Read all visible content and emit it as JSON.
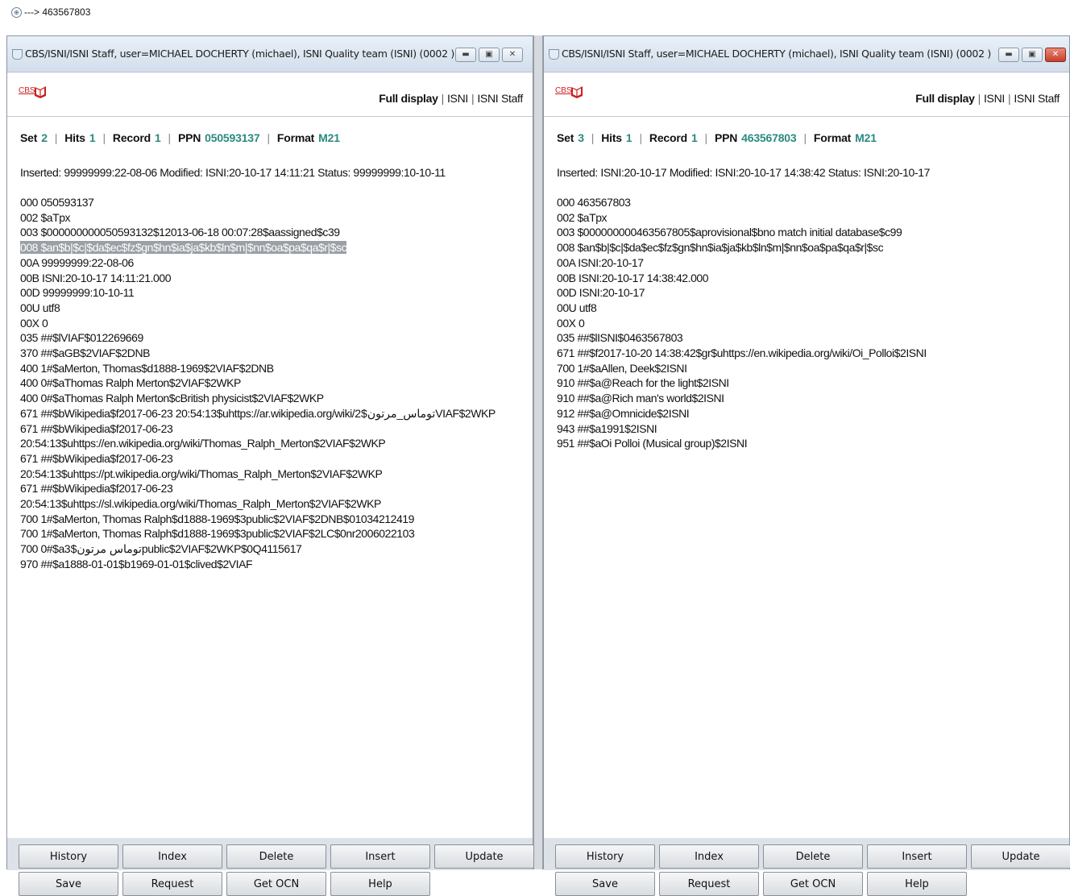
{
  "topbar": {
    "command": "---> 463567803"
  },
  "windows": [
    {
      "title": "CBS/ISNI/ISNI Staff, user=MICHAEL DOCHERTY (michael), ISNI Quality team (ISNI) (0002 )",
      "logo_text": "CBS",
      "nav": {
        "full_display": "Full display",
        "isni": "ISNI",
        "isni_staff": "ISNI Staff"
      },
      "status": {
        "set_label": "Set",
        "set": "2",
        "hits_label": "Hits",
        "hits": "1",
        "record_label": "Record",
        "record": "1",
        "ppn_label": "PPN",
        "ppn": "050593137",
        "format_label": "Format",
        "format": "M21"
      },
      "info": "Inserted: 99999999:22-08-06 Modified: ISNI:20-10-17 14:11:21 Status: 99999999:10-10-11",
      "highlighted_line": 3,
      "lines": [
        "000 050593137",
        "002 $aTpx",
        "003 $000000000050593132$12013-06-18 00:07:28$aassigned$c39",
        "008 $an$b|$c|$da$ec$fz$gn$hn$ia$ja$kb$ln$m|$nn$oa$pa$qa$r|$sc",
        "00A 99999999:22-08-06",
        "00B ISNI:20-10-17 14:11:21.000",
        "00D 99999999:10-10-11",
        "00U utf8",
        "00X 0",
        "035 ##$lVIAF$012269669",
        "370 ##$aGB$2VIAF$2DNB",
        "400 1#$aMerton, Thomas$d1888-1969$2VIAF$2DNB",
        "400 0#$aThomas Ralph Merton$2VIAF$2WKP",
        "400 0#$aThomas Ralph Merton$cBritish physicist$2VIAF$2WKP",
        "671 ##$bWikipedia$f2017-06-23 20:54:13$uhttps://ar.wikipedia.org/wiki/توماس_مرتون$2VIAF$2WKP",
        "671 ##$bWikipedia$f2017-06-23",
        "20:54:13$uhttps://en.wikipedia.org/wiki/Thomas_Ralph_Merton$2VIAF$2WKP",
        "671 ##$bWikipedia$f2017-06-23",
        "20:54:13$uhttps://pt.wikipedia.org/wiki/Thomas_Ralph_Merton$2VIAF$2WKP",
        "671 ##$bWikipedia$f2017-06-23",
        "20:54:13$uhttps://sl.wikipedia.org/wiki/Thomas_Ralph_Merton$2VIAF$2WKP",
        "700 1#$aMerton, Thomas Ralph$d1888-1969$3public$2VIAF$2DNB$01034212419",
        "700 1#$aMerton, Thomas Ralph$d1888-1969$3public$2VIAF$2LC$0nr2006022103",
        "700 0#$aتوماس مرتون$3public$2VIAF$2WKP$0Q4115617",
        "970 ##$a1888-01-01$b1969-01-01$clived$2VIAF"
      ],
      "buttons": [
        "History",
        "Index",
        "Delete",
        "Insert",
        "Update",
        "Save",
        "Request",
        "Get OCN",
        "Help"
      ]
    },
    {
      "title": "CBS/ISNI/ISNI Staff, user=MICHAEL DOCHERTY (michael), ISNI Quality team (ISNI) (0002 )",
      "logo_text": "CBS",
      "nav": {
        "full_display": "Full display",
        "isni": "ISNI",
        "isni_staff": "ISNI Staff"
      },
      "status": {
        "set_label": "Set",
        "set": "3",
        "hits_label": "Hits",
        "hits": "1",
        "record_label": "Record",
        "record": "1",
        "ppn_label": "PPN",
        "ppn": "463567803",
        "format_label": "Format",
        "format": "M21"
      },
      "info": "Inserted: ISNI:20-10-17 Modified: ISNI:20-10-17 14:38:42 Status: ISNI:20-10-17",
      "highlighted_line": -1,
      "lines": [
        "000 463567803",
        "002 $aTpx",
        "003 $000000000463567805$aprovisional$bno match initial database$c99",
        "008 $an$b|$c|$da$ec$fz$gn$hn$ia$ja$kb$ln$m|$nn$oa$pa$qa$r|$sc",
        "00A ISNI:20-10-17",
        "00B ISNI:20-10-17 14:38:42.000",
        "00D ISNI:20-10-17",
        "00U utf8",
        "00X 0",
        "035 ##$lISNI$0463567803",
        "671 ##$f2017-10-20 14:38:42$gr$uhttps://en.wikipedia.org/wiki/Oi_Polloi$2ISNI",
        "700 1#$aAllen, Deek$2ISNI",
        "910 ##$a@Reach for the light$2ISNI",
        "910 ##$a@Rich man's world$2ISNI",
        "912 ##$a@Omnicide$2ISNI",
        "943 ##$a1991$2ISNI",
        "951 ##$aOi Polloi (Musical group)$2ISNI"
      ],
      "buttons": [
        "History",
        "Index",
        "Delete",
        "Insert",
        "Update",
        "Save",
        "Request",
        "Get OCN",
        "Help"
      ]
    }
  ],
  "icons": {
    "command_icon": "magnifier-icon",
    "app_icon": "shield-icon",
    "logo": "cbs-book-logo"
  },
  "colors": {
    "value_teal": "#2a8a80",
    "logo_red": "#cc1f1f",
    "close_red": "#c6402a"
  }
}
